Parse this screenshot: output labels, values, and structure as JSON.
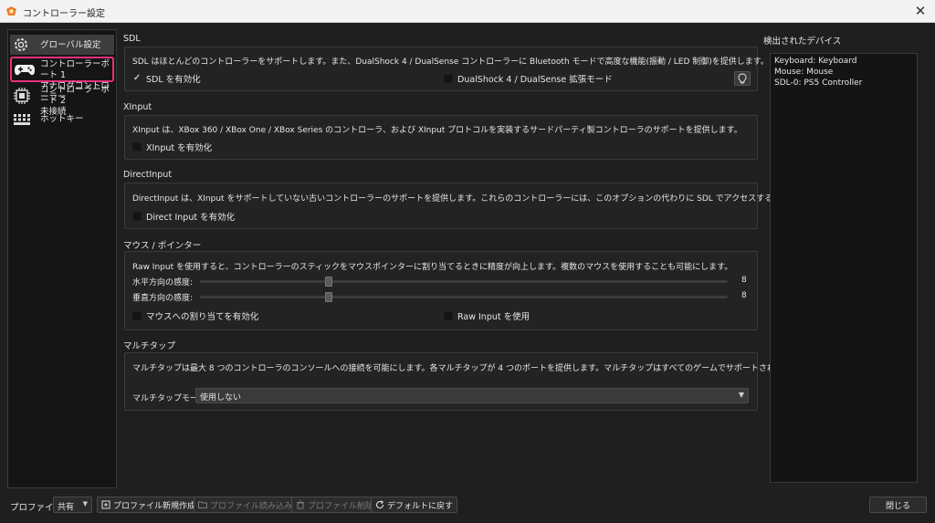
{
  "window": {
    "title": "コントローラー設定",
    "close_label": "✕"
  },
  "sidebar": {
    "items": [
      {
        "label": "グローバル設定"
      },
      {
        "label_line1": "コントローラーポート 1",
        "label_line2": "アナログコントローラー"
      },
      {
        "label_line1": "コントローラーポート 2",
        "label_line2": "未接続"
      },
      {
        "label": "ホットキー"
      }
    ]
  },
  "sdl": {
    "title": "SDL",
    "description": "SDL はほとんどのコントローラーをサポートします。また、DualShock 4 / DualSense コントローラーに Bluetooth モードで高度な機能(振動 / LED 制御)を提供します。",
    "enable_label": "SDL を有効化",
    "enable_checked": true,
    "ds4_label": "DualShock 4 / DualSense 拡張モード",
    "ds4_checked": false
  },
  "xinput": {
    "title": "XInput",
    "description": "XInput は、XBox 360 / XBox One / XBox Series のコントローラ、および XInput プロトコルを実装するサードパーティ製コントローラのサポートを提供します。",
    "enable_label": "XInput を有効化",
    "enable_checked": false
  },
  "directinput": {
    "title": "DirectInput",
    "description": "DirectInput は、XInput をサポートしていない古いコントローラーのサポートを提供します。これらのコントローラーには、このオプションの代わりに SDL でアクセスすることをお勧めします。",
    "enable_label": "Direct Input を有効化",
    "enable_checked": false
  },
  "mouse": {
    "title": "マウス / ポインター",
    "description": "Raw Input を使用すると、コントローラーのスティックをマウスポインターに割り当てるときに精度が向上します。複数のマウスを使用することも可能にします。",
    "h_label": "水平方向の感度:",
    "h_value": "8",
    "h_fraction": 0.24,
    "v_label": "垂直方向の感度:",
    "v_value": "8",
    "v_fraction": 0.24,
    "map_label": "マウスへの割り当てを有効化",
    "map_checked": false,
    "raw_label": "Raw Input を使用",
    "raw_checked": false
  },
  "multitap": {
    "title": "マルチタップ",
    "description": "マルチタップは最大 8 つのコントローラのコンソールへの接続を可能にします。各マルチタップが 4 つのポートを提供します。マルチタップはすべてのゲームでサポートされているわけではありません。",
    "mode_label": "マルチタップモード:",
    "mode_value": "使用しない"
  },
  "devices": {
    "title": "検出されたデバイス",
    "items": [
      "Keyboard: Keyboard",
      "Mouse: Mouse",
      "SDL-0: PS5 Controller"
    ]
  },
  "bottom": {
    "profile_label": "プロファイル:",
    "profile_value": "共有",
    "new_profile": "プロファイル新規作成",
    "load_profile": "プロファイル読み込み",
    "delete_profile": "プロファイル削除",
    "reset_default": "デフォルトに戻す",
    "close": "閉じる"
  },
  "colors": {
    "highlight": "#e8307a",
    "background": "#1f1f1f",
    "selected": "#3d3d3d"
  }
}
